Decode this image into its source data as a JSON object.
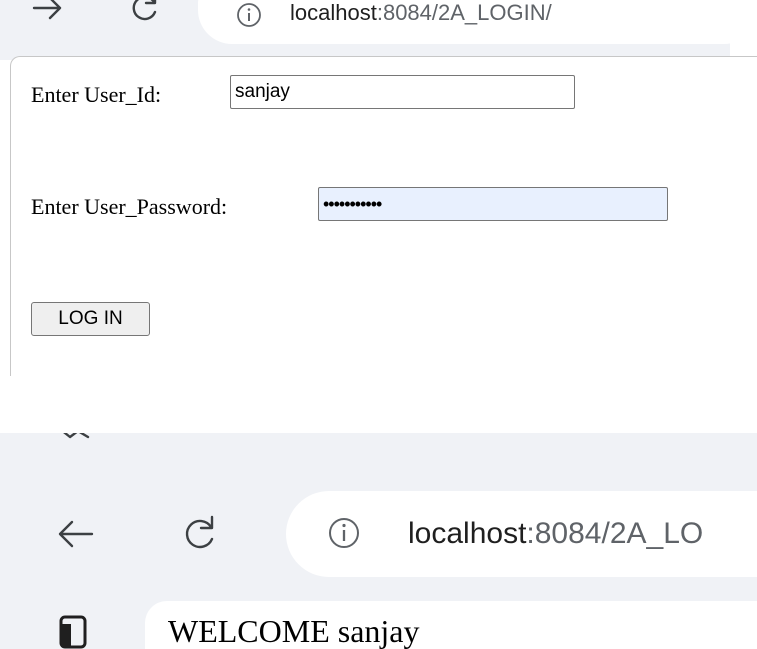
{
  "login_screen": {
    "browser": {
      "url_host": "localhost",
      "url_path": ":8084/2A_LOGIN/"
    },
    "form": {
      "user_id_label": "Enter User_Id:",
      "user_id_value": "sanjay",
      "password_label": "Enter User_Password:",
      "password_masked": "•••••••••••",
      "login_button": "LOG IN"
    }
  },
  "welcome_screen": {
    "browser": {
      "url_host": "localhost",
      "url_path": ":8084/2A_LO"
    },
    "message": "WELCOME sanjay"
  },
  "icons": {
    "forward": "arrow-forward-icon",
    "back": "arrow-back-icon",
    "reload": "reload-icon",
    "info": "info-icon",
    "sidebar": "sidebar-panel-icon"
  }
}
